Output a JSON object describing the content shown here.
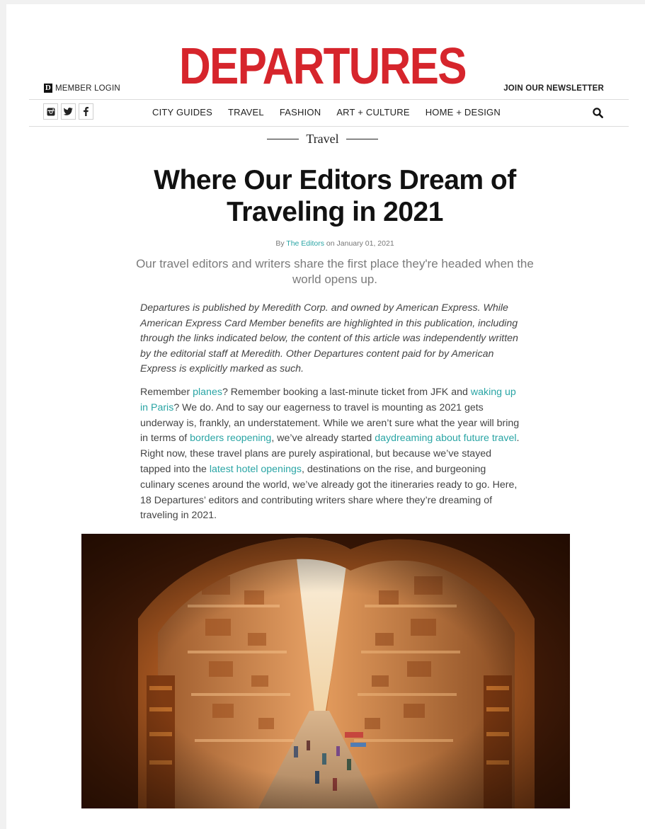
{
  "masthead": {
    "logo": "DEPARTURES",
    "member_login": "MEMBER LOGIN",
    "member_badge": "D",
    "newsletter": "JOIN OUR NEWSLETTER"
  },
  "social": [
    "instagram-icon",
    "twitter-icon",
    "facebook-icon"
  ],
  "nav": {
    "items": [
      "CITY GUIDES",
      "TRAVEL",
      "FASHION",
      "ART + CULTURE",
      "HOME + DESIGN"
    ]
  },
  "article": {
    "section": "Travel",
    "title": "Where Our Editors Dream of Traveling in 2021",
    "byline_prefix": "By ",
    "author": "The Editors",
    "byline_date": " on January 01, 2021",
    "dek": "Our travel editors and writers share the first place they're headed when the world opens up.",
    "disclaimer": "Departures is published by Meredith Corp. and owned by American Express. While American Express Card Member benefits are highlighted in this publication, including through the links indicated below, the content of this article was independently written by the editorial staff at Meredith. Other Departures content paid for by American Express is explicitly marked as such.",
    "body": {
      "t1": "Remember ",
      "l1": "planes",
      "t2": "? Remember booking a last-minute ticket from JFK and ",
      "l2": "waking up in Paris",
      "t3": "? We do. And to say our eagerness to travel is mounting as 2021 gets underway is, frankly, an understatement. While we aren’t sure what the year will bring in terms of ",
      "l3": "borders reopening",
      "t4": ", we’ve already started ",
      "l4": "daydreaming about future travel",
      "t5": ". Right now, these travel plans are purely aspirational, but because we’ve stayed tapped into the ",
      "l5": "latest hotel openings",
      "t6": ", destinations on the rise, and burgeoning culinary scenes around the world, we’ve already got the itineraries ready to go. Here, 18 Departures’ editors and contributing writers share where they’re dreaming of traveling in 2021."
    }
  },
  "colors": {
    "brand_red": "#d6252c",
    "link_teal": "#2aa5a5"
  }
}
